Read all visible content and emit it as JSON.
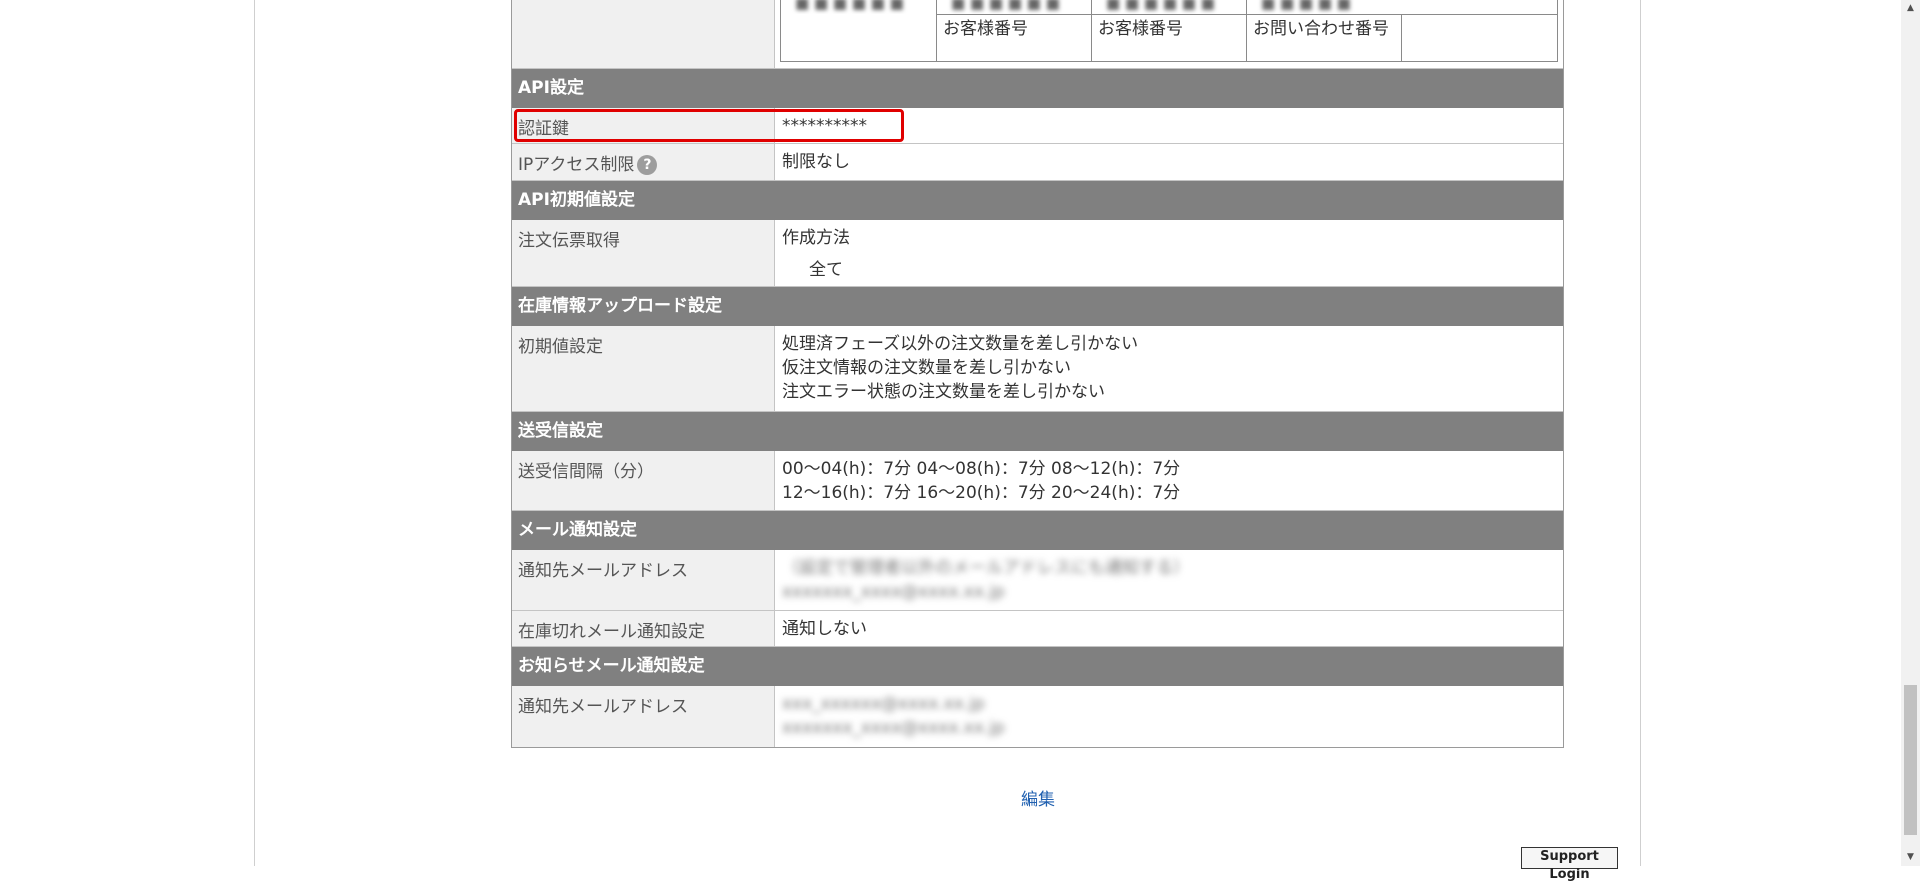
{
  "top_subtable": {
    "cells": [
      "お客様番号",
      "お客様番号",
      "お問い合わせ番号",
      ""
    ]
  },
  "api_settings": {
    "header": "API設定",
    "auth_key_label": "認証鍵",
    "auth_key_value": "**********",
    "ip_access_label": "IPアクセス制限",
    "ip_access_help": "?",
    "ip_access_value": "制限なし"
  },
  "api_defaults": {
    "header": "API初期値設定",
    "order_slip_label": "注文伝票取得",
    "order_slip_method": "作成方法",
    "order_slip_value": "全て"
  },
  "stock_upload": {
    "header": "在庫情報アップロード設定",
    "initial_label": "初期値設定",
    "lines": [
      "処理済フェーズ以外の注文数量を差し引かない",
      "仮注文情報の注文数量を差し引かない",
      "注文エラー状態の注文数量を差し引かない"
    ]
  },
  "transfer": {
    "header": "送受信設定",
    "interval_label": "送受信間隔（分）",
    "lines": [
      "00～04(h)：7分 04～08(h)：7分 08～12(h)：7分",
      "12～16(h)：7分 16～20(h)：7分 20～24(h)：7分"
    ]
  },
  "mail_notify": {
    "header": "メール通知設定",
    "address_label": "通知先メールアドレス",
    "address_lines": [
      "（設定で管理者以外のメールアドレスにも通知する）",
      "xxxxxxx_xxxx@xxxx.xx.jp"
    ],
    "stockout_label": "在庫切れメール通知設定",
    "stockout_value": "通知しない"
  },
  "news_notify": {
    "header": "お知らせメール通知設定",
    "address_label": "通知先メールアドレス",
    "address_lines": [
      "xxx_xxxxxx@xxxx.xx.jp",
      "xxxxxxx_xxxx@xxxx.xx.jp"
    ]
  },
  "actions": {
    "edit_label": "編集",
    "support_login_label": "Support Login"
  },
  "colors": {
    "section_header_bg": "#808080",
    "highlight": "#e00000",
    "link": "#2060b0"
  }
}
